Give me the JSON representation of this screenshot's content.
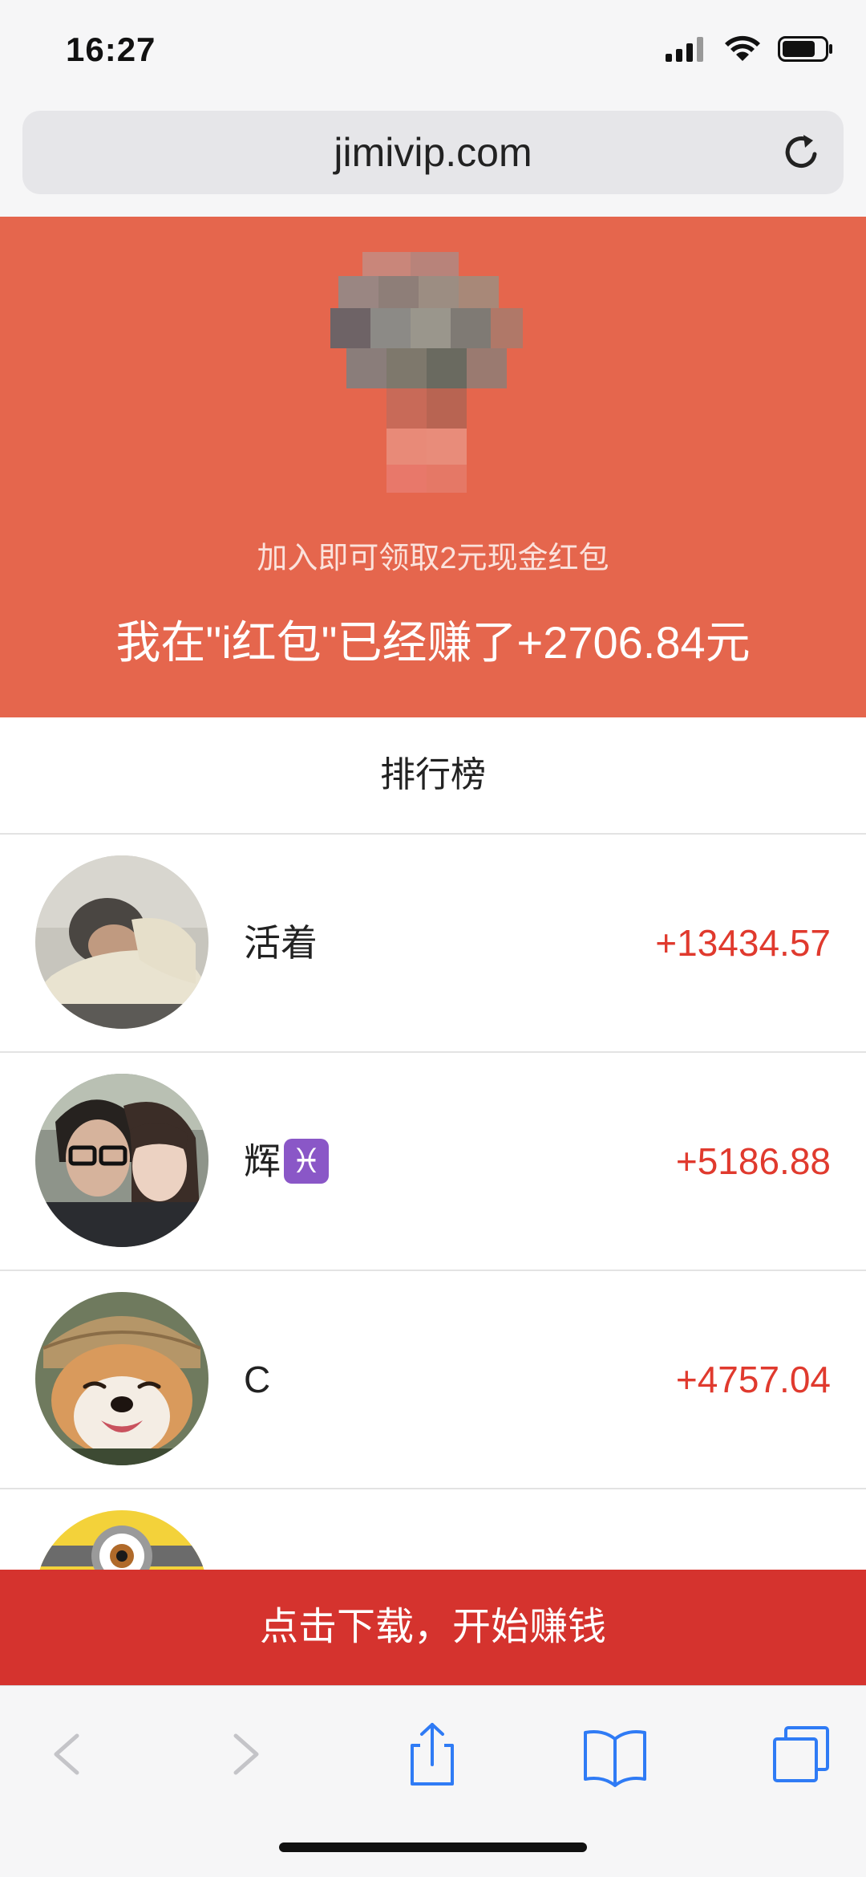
{
  "status_bar": {
    "time": "16:27"
  },
  "browser": {
    "url": "jimivip.com"
  },
  "hero": {
    "promo_text": "加入即可领取2元现金红包",
    "earned_text": "我在\"i红包\"已经赚了+2706.84元",
    "background_color": "#e5664d"
  },
  "ranking": {
    "title": "排行榜",
    "entries": [
      {
        "name": "活着",
        "amount": "+13434.57"
      },
      {
        "name": "辉",
        "zodiac": "♓",
        "amount": "+5186.88"
      },
      {
        "name": "C",
        "amount": "+4757.04"
      }
    ],
    "amount_color": "#e03a2e"
  },
  "download": {
    "label": "点击下载，开始赚钱",
    "background_color": "#d5332e"
  },
  "toolbar": {
    "icons": [
      "back-icon",
      "forward-icon",
      "share-icon",
      "bookmarks-icon",
      "tabs-icon"
    ]
  }
}
